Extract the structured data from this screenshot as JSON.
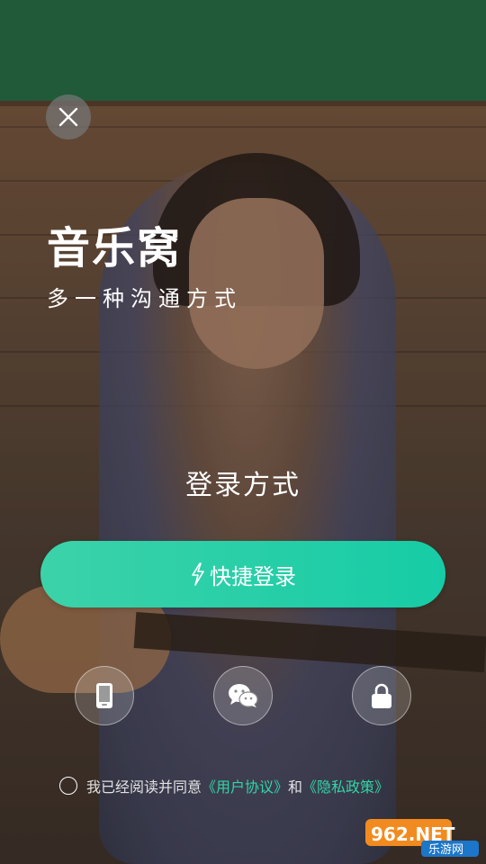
{
  "app": {
    "title": "音乐窝",
    "subtitle": "多一种沟通方式"
  },
  "login": {
    "heading": "登录方式",
    "quick_login_label": "快捷登录",
    "methods": [
      {
        "name": "phone-login",
        "icon": "phone-icon"
      },
      {
        "name": "wechat-login",
        "icon": "wechat-icon"
      },
      {
        "name": "password-login",
        "icon": "lock-icon"
      }
    ]
  },
  "agreement": {
    "prefix": "我已经阅读并同意",
    "user_agreement": "《用户协议》",
    "conjunction": "和",
    "privacy_policy": "《隐私政策》"
  },
  "watermark": {
    "logo_text": "962.NET",
    "site_name": "乐游网"
  },
  "colors": {
    "accent": "#1fd0a8",
    "link": "#32d5a6"
  }
}
